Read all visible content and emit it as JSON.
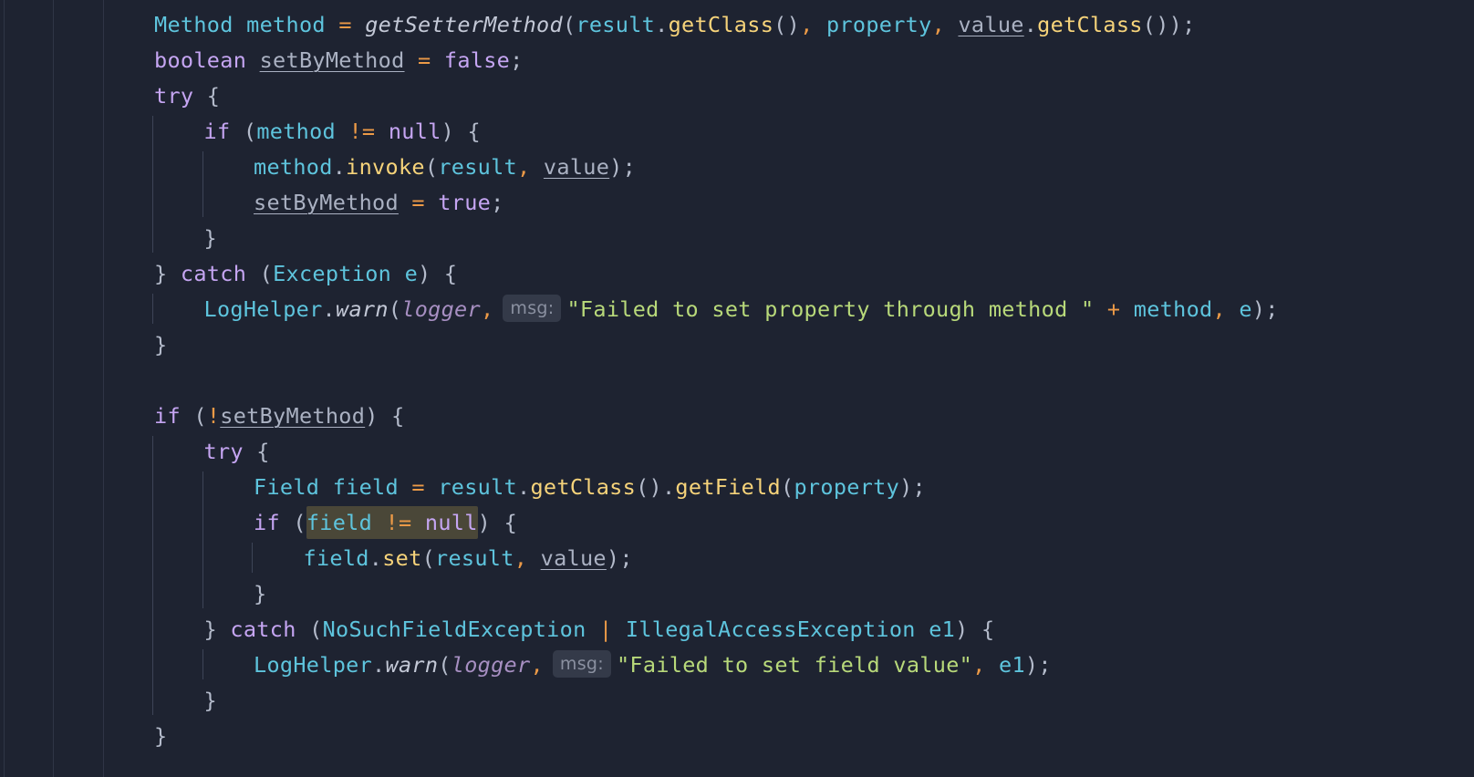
{
  "editor": {
    "language": "java",
    "inlay_hint_label": "msg:",
    "colors": {
      "background": "#1e2331",
      "type": "#5ec4dd",
      "keyword": "#c5a5f2",
      "function": "#f6d37a",
      "string": "#b8d97a",
      "operator": "#ec9a47",
      "parameter": "#a78fc2"
    },
    "lines": [
      {
        "indent": 0,
        "tokens": [
          {
            "t": "Method",
            "k": "type"
          },
          {
            "t": " ",
            "k": "plain"
          },
          {
            "t": "method",
            "k": "var"
          },
          {
            "t": " ",
            "k": "plain"
          },
          {
            "t": "=",
            "k": "op"
          },
          {
            "t": " ",
            "k": "plain"
          },
          {
            "t": "getSetterMethod",
            "k": "fni"
          },
          {
            "t": "(",
            "k": "punc"
          },
          {
            "t": "result",
            "k": "var"
          },
          {
            "t": ".",
            "k": "punc"
          },
          {
            "t": "getClass",
            "k": "fn"
          },
          {
            "t": "()",
            "k": "punc"
          },
          {
            "t": ",",
            "k": "op"
          },
          {
            "t": " ",
            "k": "plain"
          },
          {
            "t": "property",
            "k": "var"
          },
          {
            "t": ",",
            "k": "op"
          },
          {
            "t": " ",
            "k": "plain"
          },
          {
            "t": "value",
            "k": "under"
          },
          {
            "t": ".",
            "k": "punc"
          },
          {
            "t": "getClass",
            "k": "fn"
          },
          {
            "t": "());",
            "k": "punc"
          }
        ]
      },
      {
        "indent": 0,
        "tokens": [
          {
            "t": "boolean",
            "k": "kw"
          },
          {
            "t": " ",
            "k": "plain"
          },
          {
            "t": "setByMethod",
            "k": "under"
          },
          {
            "t": " ",
            "k": "plain"
          },
          {
            "t": "=",
            "k": "op"
          },
          {
            "t": " ",
            "k": "plain"
          },
          {
            "t": "false",
            "k": "kw"
          },
          {
            "t": ";",
            "k": "punc"
          }
        ]
      },
      {
        "indent": 0,
        "tokens": [
          {
            "t": "try",
            "k": "kw"
          },
          {
            "t": " {",
            "k": "punc"
          }
        ]
      },
      {
        "indent": 1,
        "tokens": [
          {
            "t": "if",
            "k": "kw"
          },
          {
            "t": " (",
            "k": "punc"
          },
          {
            "t": "method",
            "k": "var"
          },
          {
            "t": " ",
            "k": "plain"
          },
          {
            "t": "!=",
            "k": "op"
          },
          {
            "t": " ",
            "k": "plain"
          },
          {
            "t": "null",
            "k": "kw"
          },
          {
            "t": ") {",
            "k": "punc"
          }
        ]
      },
      {
        "indent": 2,
        "tokens": [
          {
            "t": "method",
            "k": "var"
          },
          {
            "t": ".",
            "k": "punc"
          },
          {
            "t": "invoke",
            "k": "fn"
          },
          {
            "t": "(",
            "k": "punc"
          },
          {
            "t": "result",
            "k": "var"
          },
          {
            "t": ",",
            "k": "op"
          },
          {
            "t": " ",
            "k": "plain"
          },
          {
            "t": "value",
            "k": "under"
          },
          {
            "t": ");",
            "k": "punc"
          }
        ]
      },
      {
        "indent": 2,
        "tokens": [
          {
            "t": "setByMethod",
            "k": "under"
          },
          {
            "t": " ",
            "k": "plain"
          },
          {
            "t": "=",
            "k": "op"
          },
          {
            "t": " ",
            "k": "plain"
          },
          {
            "t": "true",
            "k": "kw"
          },
          {
            "t": ";",
            "k": "punc"
          }
        ]
      },
      {
        "indent": 1,
        "tokens": [
          {
            "t": "}",
            "k": "punc"
          }
        ]
      },
      {
        "indent": 0,
        "tokens": [
          {
            "t": "} ",
            "k": "punc"
          },
          {
            "t": "catch",
            "k": "kw"
          },
          {
            "t": " (",
            "k": "punc"
          },
          {
            "t": "Exception",
            "k": "type"
          },
          {
            "t": " ",
            "k": "plain"
          },
          {
            "t": "e",
            "k": "var"
          },
          {
            "t": ") {",
            "k": "punc"
          }
        ]
      },
      {
        "indent": 1,
        "tokens": [
          {
            "t": "LogHelper",
            "k": "type"
          },
          {
            "t": ".",
            "k": "punc"
          },
          {
            "t": "warn",
            "k": "fni"
          },
          {
            "t": "(",
            "k": "punc"
          },
          {
            "t": "logger",
            "k": "param"
          },
          {
            "t": ",",
            "k": "op"
          },
          {
            "t": "msg:",
            "k": "hint"
          },
          {
            "t": "\"Failed to set property through method \"",
            "k": "str"
          },
          {
            "t": " ",
            "k": "plain"
          },
          {
            "t": "+",
            "k": "op"
          },
          {
            "t": " ",
            "k": "plain"
          },
          {
            "t": "method",
            "k": "var"
          },
          {
            "t": ",",
            "k": "op"
          },
          {
            "t": " ",
            "k": "plain"
          },
          {
            "t": "e",
            "k": "var"
          },
          {
            "t": ");",
            "k": "punc"
          }
        ]
      },
      {
        "indent": 0,
        "tokens": [
          {
            "t": "}",
            "k": "punc"
          }
        ]
      },
      {
        "indent": 0,
        "tokens": []
      },
      {
        "indent": 0,
        "tokens": [
          {
            "t": "if",
            "k": "kw"
          },
          {
            "t": " (",
            "k": "punc"
          },
          {
            "t": "!",
            "k": "op"
          },
          {
            "t": "setByMethod",
            "k": "under"
          },
          {
            "t": ") {",
            "k": "punc"
          }
        ]
      },
      {
        "indent": 1,
        "tokens": [
          {
            "t": "try",
            "k": "kw"
          },
          {
            "t": " {",
            "k": "punc"
          }
        ]
      },
      {
        "indent": 2,
        "tokens": [
          {
            "t": "Field",
            "k": "type"
          },
          {
            "t": " ",
            "k": "plain"
          },
          {
            "t": "field",
            "k": "var"
          },
          {
            "t": " ",
            "k": "plain"
          },
          {
            "t": "=",
            "k": "op"
          },
          {
            "t": " ",
            "k": "plain"
          },
          {
            "t": "result",
            "k": "var"
          },
          {
            "t": ".",
            "k": "punc"
          },
          {
            "t": "getClass",
            "k": "fn"
          },
          {
            "t": "().",
            "k": "punc"
          },
          {
            "t": "getField",
            "k": "fn"
          },
          {
            "t": "(",
            "k": "punc"
          },
          {
            "t": "property",
            "k": "var"
          },
          {
            "t": ");",
            "k": "punc"
          }
        ]
      },
      {
        "indent": 2,
        "tokens": [
          {
            "t": "if",
            "k": "kw"
          },
          {
            "t": " (",
            "k": "punc"
          },
          {
            "t": "field",
            "k": "var",
            "hl": true
          },
          {
            "t": " ",
            "k": "plain",
            "hl": true
          },
          {
            "t": "!=",
            "k": "op",
            "hl": true
          },
          {
            "t": " ",
            "k": "plain",
            "hl": true
          },
          {
            "t": "null",
            "k": "kw",
            "hl": true
          },
          {
            "t": ") {",
            "k": "punc"
          }
        ]
      },
      {
        "indent": 3,
        "tokens": [
          {
            "t": "field",
            "k": "var"
          },
          {
            "t": ".",
            "k": "punc"
          },
          {
            "t": "set",
            "k": "fn"
          },
          {
            "t": "(",
            "k": "punc"
          },
          {
            "t": "result",
            "k": "var"
          },
          {
            "t": ",",
            "k": "op"
          },
          {
            "t": " ",
            "k": "plain"
          },
          {
            "t": "value",
            "k": "under"
          },
          {
            "t": ");",
            "k": "punc"
          }
        ]
      },
      {
        "indent": 2,
        "tokens": [
          {
            "t": "}",
            "k": "punc"
          }
        ]
      },
      {
        "indent": 1,
        "tokens": [
          {
            "t": "} ",
            "k": "punc"
          },
          {
            "t": "catch",
            "k": "kw"
          },
          {
            "t": " (",
            "k": "punc"
          },
          {
            "t": "NoSuchFieldException",
            "k": "type"
          },
          {
            "t": " ",
            "k": "plain"
          },
          {
            "t": "|",
            "k": "op"
          },
          {
            "t": " ",
            "k": "plain"
          },
          {
            "t": "IllegalAccessException",
            "k": "type"
          },
          {
            "t": " ",
            "k": "plain"
          },
          {
            "t": "e1",
            "k": "var"
          },
          {
            "t": ") {",
            "k": "punc"
          }
        ]
      },
      {
        "indent": 2,
        "tokens": [
          {
            "t": "LogHelper",
            "k": "type"
          },
          {
            "t": ".",
            "k": "punc"
          },
          {
            "t": "warn",
            "k": "fni"
          },
          {
            "t": "(",
            "k": "punc"
          },
          {
            "t": "logger",
            "k": "param"
          },
          {
            "t": ",",
            "k": "op"
          },
          {
            "t": "msg:",
            "k": "hint"
          },
          {
            "t": "\"Failed to set field value\"",
            "k": "str"
          },
          {
            "t": ",",
            "k": "op"
          },
          {
            "t": " ",
            "k": "plain"
          },
          {
            "t": "e1",
            "k": "var"
          },
          {
            "t": ");",
            "k": "punc"
          }
        ]
      },
      {
        "indent": 1,
        "tokens": [
          {
            "t": "}",
            "k": "punc"
          }
        ]
      },
      {
        "indent": 0,
        "tokens": [
          {
            "t": "}",
            "k": "punc"
          }
        ]
      }
    ]
  }
}
